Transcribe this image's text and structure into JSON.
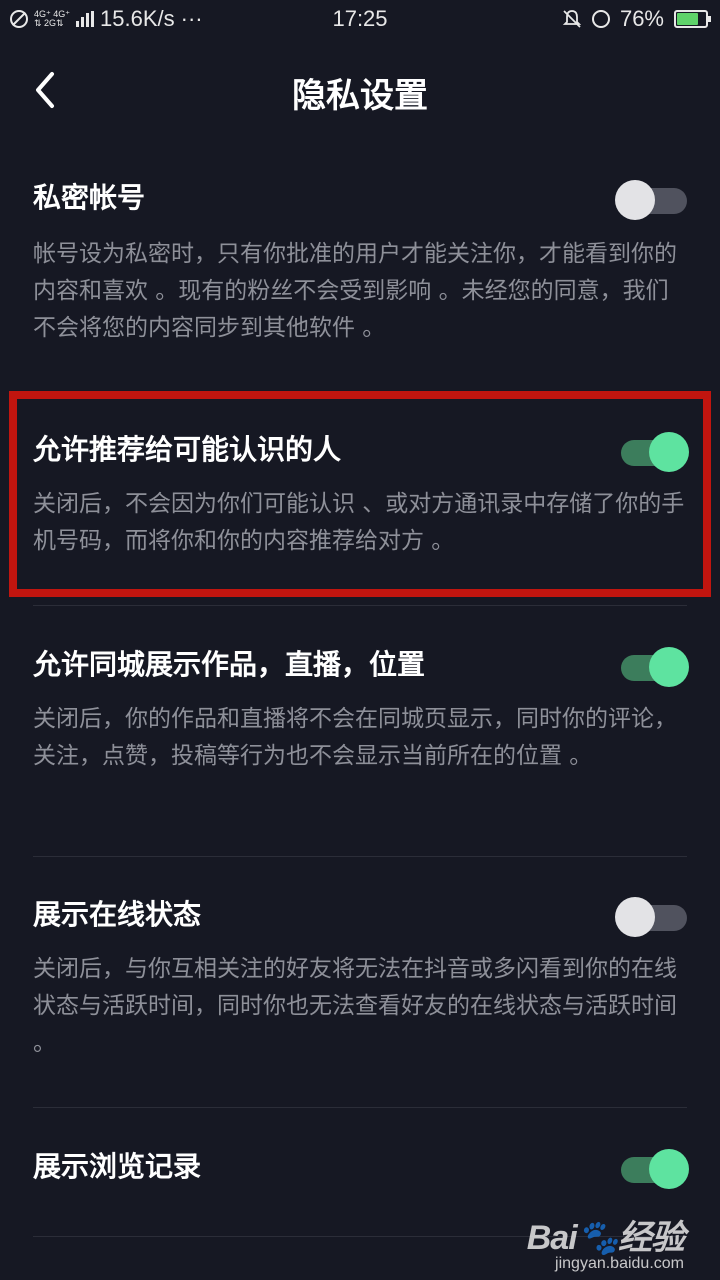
{
  "status_bar": {
    "network_top": "4G⁺ 4G⁺",
    "network_bottom": "⇅ 2G⇅",
    "speed": "15.6K/s",
    "more": "···",
    "time": "17:25",
    "battery": "76%",
    "battery_level": 0.76
  },
  "header": {
    "title": "隐私设置",
    "back_icon": "chevron-left-icon"
  },
  "settings": [
    {
      "title": "私密帐号",
      "description": "帐号设为私密时，只有你批准的用户才能关注你，才能看到你的内容和喜欢 。现有的粉丝不会受到影响 。未经您的同意，我们不会将您的内容同步到其他软件 。",
      "enabled": false
    },
    {
      "title": "允许推荐给可能认识的人",
      "description": "关闭后，不会因为你们可能认识 、或对方通讯录中存储了你的手机号码，而将你和你的内容推荐给对方 。",
      "enabled": true
    },
    {
      "title": "允许同城展示作品，直播，位置",
      "description": "关闭后，你的作品和直播将不会在同城页显示，同时你的评论，关注，点赞，投稿等行为也不会显示当前所在的位置 。",
      "enabled": true
    },
    {
      "title": "展示在线状态",
      "description": "关闭后，与你互相关注的好友将无法在抖音或多闪看到你的在线状态与活跃时间，同时你也无法查看好友的在线状态与活跃时间 。",
      "enabled": false
    },
    {
      "title": "展示浏览记录",
      "enabled": true
    }
  ],
  "colors": {
    "background": "#161823",
    "toggle_on": "#5ee3a0",
    "toggle_off": "#e3e3e6",
    "highlight": "#c1150f"
  },
  "watermark": {
    "logo": "Bai🐾经验",
    "url": "jingyan.baidu.com"
  }
}
